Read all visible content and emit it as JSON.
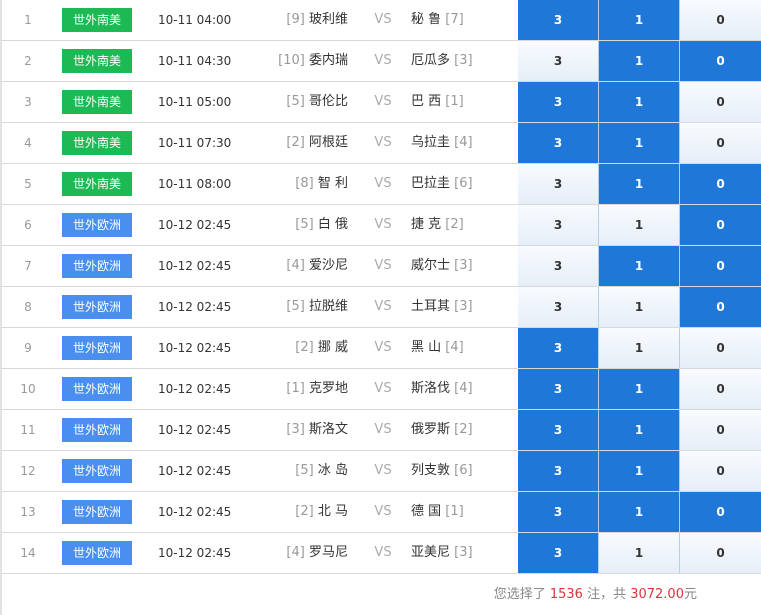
{
  "colors": {
    "league_south_america": "#1db954",
    "league_europe": "#4a8ef0",
    "selected": "#1f78d8",
    "highlight": "#d9343e"
  },
  "vs_label": "VS",
  "matches": [
    {
      "index": "1",
      "league": "世外南美",
      "league_type": "sa",
      "time": "10-11 04:00",
      "home_rank": "[9]",
      "home": "玻利维",
      "away": "秘 鲁",
      "away_rank": "[7]",
      "odds": [
        {
          "label": "3",
          "selected": true
        },
        {
          "label": "1",
          "selected": true
        },
        {
          "label": "0",
          "selected": false
        }
      ]
    },
    {
      "index": "2",
      "league": "世外南美",
      "league_type": "sa",
      "time": "10-11 04:30",
      "home_rank": "[10]",
      "home": "委内瑞",
      "away": "厄瓜多",
      "away_rank": "[3]",
      "odds": [
        {
          "label": "3",
          "selected": false
        },
        {
          "label": "1",
          "selected": true
        },
        {
          "label": "0",
          "selected": true
        }
      ]
    },
    {
      "index": "3",
      "league": "世外南美",
      "league_type": "sa",
      "time": "10-11 05:00",
      "home_rank": "[5]",
      "home": "哥伦比",
      "away": "巴 西",
      "away_rank": "[1]",
      "odds": [
        {
          "label": "3",
          "selected": true
        },
        {
          "label": "1",
          "selected": true
        },
        {
          "label": "0",
          "selected": false
        }
      ]
    },
    {
      "index": "4",
      "league": "世外南美",
      "league_type": "sa",
      "time": "10-11 07:30",
      "home_rank": "[2]",
      "home": "阿根廷",
      "away": "乌拉圭",
      "away_rank": "[4]",
      "odds": [
        {
          "label": "3",
          "selected": true
        },
        {
          "label": "1",
          "selected": true
        },
        {
          "label": "0",
          "selected": false
        }
      ]
    },
    {
      "index": "5",
      "league": "世外南美",
      "league_type": "sa",
      "time": "10-11 08:00",
      "home_rank": "[8]",
      "home": "智 利",
      "away": "巴拉圭",
      "away_rank": "[6]",
      "odds": [
        {
          "label": "3",
          "selected": false
        },
        {
          "label": "1",
          "selected": true
        },
        {
          "label": "0",
          "selected": true
        }
      ]
    },
    {
      "index": "6",
      "league": "世外欧洲",
      "league_type": "eu",
      "time": "10-12 02:45",
      "home_rank": "[5]",
      "home": "白 俄",
      "away": "捷 克",
      "away_rank": "[2]",
      "odds": [
        {
          "label": "3",
          "selected": false
        },
        {
          "label": "1",
          "selected": false
        },
        {
          "label": "0",
          "selected": true
        }
      ]
    },
    {
      "index": "7",
      "league": "世外欧洲",
      "league_type": "eu",
      "time": "10-12 02:45",
      "home_rank": "[4]",
      "home": "爱沙尼",
      "away": "威尔士",
      "away_rank": "[3]",
      "odds": [
        {
          "label": "3",
          "selected": false
        },
        {
          "label": "1",
          "selected": true
        },
        {
          "label": "0",
          "selected": true
        }
      ]
    },
    {
      "index": "8",
      "league": "世外欧洲",
      "league_type": "eu",
      "time": "10-12 02:45",
      "home_rank": "[5]",
      "home": "拉脱维",
      "away": "土耳其",
      "away_rank": "[3]",
      "odds": [
        {
          "label": "3",
          "selected": false
        },
        {
          "label": "1",
          "selected": false
        },
        {
          "label": "0",
          "selected": true
        }
      ]
    },
    {
      "index": "9",
      "league": "世外欧洲",
      "league_type": "eu",
      "time": "10-12 02:45",
      "home_rank": "[2]",
      "home": "挪 威",
      "away": "黑 山",
      "away_rank": "[4]",
      "odds": [
        {
          "label": "3",
          "selected": true
        },
        {
          "label": "1",
          "selected": false
        },
        {
          "label": "0",
          "selected": false
        }
      ]
    },
    {
      "index": "10",
      "league": "世外欧洲",
      "league_type": "eu",
      "time": "10-12 02:45",
      "home_rank": "[1]",
      "home": "克罗地",
      "away": "斯洛伐",
      "away_rank": "[4]",
      "odds": [
        {
          "label": "3",
          "selected": true
        },
        {
          "label": "1",
          "selected": true
        },
        {
          "label": "0",
          "selected": false
        }
      ]
    },
    {
      "index": "11",
      "league": "世外欧洲",
      "league_type": "eu",
      "time": "10-12 02:45",
      "home_rank": "[3]",
      "home": "斯洛文",
      "away": "俄罗斯",
      "away_rank": "[2]",
      "odds": [
        {
          "label": "3",
          "selected": true
        },
        {
          "label": "1",
          "selected": true
        },
        {
          "label": "0",
          "selected": false
        }
      ]
    },
    {
      "index": "12",
      "league": "世外欧洲",
      "league_type": "eu",
      "time": "10-12 02:45",
      "home_rank": "[5]",
      "home": "冰 岛",
      "away": "列支敦",
      "away_rank": "[6]",
      "odds": [
        {
          "label": "3",
          "selected": true
        },
        {
          "label": "1",
          "selected": true
        },
        {
          "label": "0",
          "selected": false
        }
      ]
    },
    {
      "index": "13",
      "league": "世外欧洲",
      "league_type": "eu",
      "time": "10-12 02:45",
      "home_rank": "[2]",
      "home": "北 马",
      "away": "德 国",
      "away_rank": "[1]",
      "odds": [
        {
          "label": "3",
          "selected": true
        },
        {
          "label": "1",
          "selected": true
        },
        {
          "label": "0",
          "selected": true
        }
      ]
    },
    {
      "index": "14",
      "league": "世外欧洲",
      "league_type": "eu",
      "time": "10-12 02:45",
      "home_rank": "[4]",
      "home": "罗马尼",
      "away": "亚美尼",
      "away_rank": "[3]",
      "odds": [
        {
          "label": "3",
          "selected": true
        },
        {
          "label": "1",
          "selected": false
        },
        {
          "label": "0",
          "selected": false
        }
      ]
    }
  ],
  "summary": {
    "prefix": "您选择了 ",
    "bets": "1536",
    "middle": " 注，共 ",
    "amount": "3072.00",
    "suffix": "元"
  }
}
